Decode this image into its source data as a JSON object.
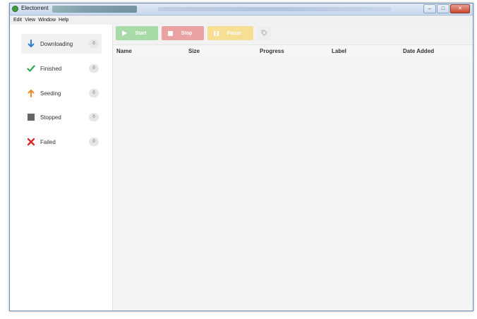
{
  "window": {
    "title": "Electorrent",
    "controls": {
      "minimize": "–",
      "maximize": "□",
      "close": "✕"
    }
  },
  "menu": [
    "Edit",
    "View",
    "Window",
    "Help"
  ],
  "sidebar": {
    "items": [
      {
        "label": "Downloading",
        "count": "0",
        "icon": "arrow-down-icon",
        "color": "#2f7fd0",
        "active": true
      },
      {
        "label": "Finished",
        "count": "0",
        "icon": "check-icon",
        "color": "#2fa84f"
      },
      {
        "label": "Seeding",
        "count": "0",
        "icon": "arrow-up-icon",
        "color": "#f08a24"
      },
      {
        "label": "Stopped",
        "count": "0",
        "icon": "stop-square-icon",
        "color": "#666666"
      },
      {
        "label": "Failed",
        "count": "0",
        "icon": "x-icon",
        "color": "#d92a2a"
      }
    ]
  },
  "toolbar": {
    "start_label": "Start",
    "stop_label": "Stop",
    "pause_label": "Pause"
  },
  "table": {
    "columns": [
      "Name",
      "Size",
      "Progress",
      "Label",
      "Date Added"
    ]
  }
}
